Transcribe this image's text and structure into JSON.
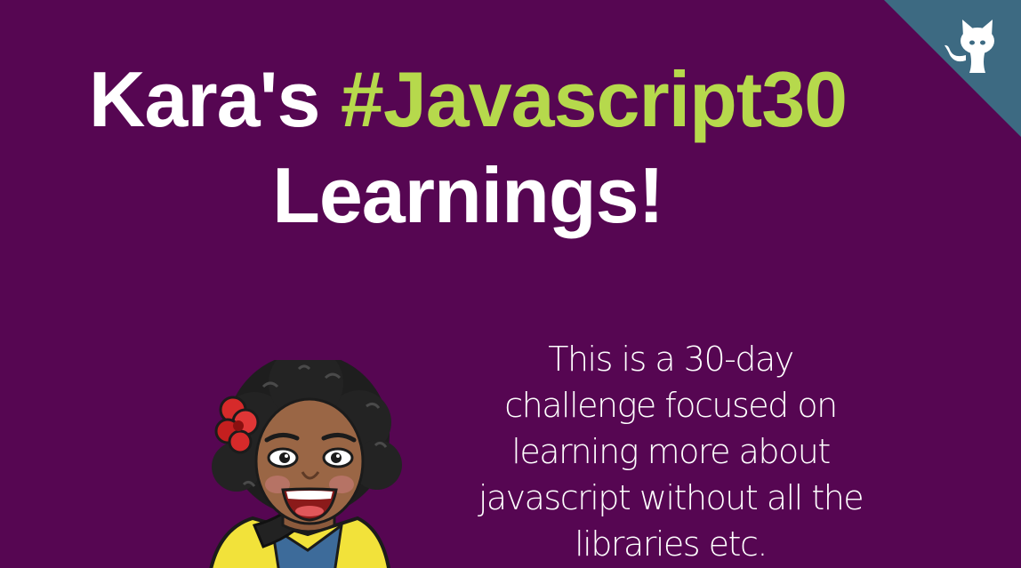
{
  "header": {
    "title_prefix": "Kara's",
    "title_hashtag": "#Javascript30",
    "title_suffix": "Learnings!"
  },
  "intro": {
    "description": "This is a 30-day challenge focused on learning more about javascript without all the libraries etc."
  },
  "colors": {
    "background": "#560652",
    "accent": "#b6d94c",
    "corner_ribbon": "#3d6a82",
    "text": "#ffffff"
  },
  "icons": {
    "github_corner": "github-octocat-icon"
  }
}
